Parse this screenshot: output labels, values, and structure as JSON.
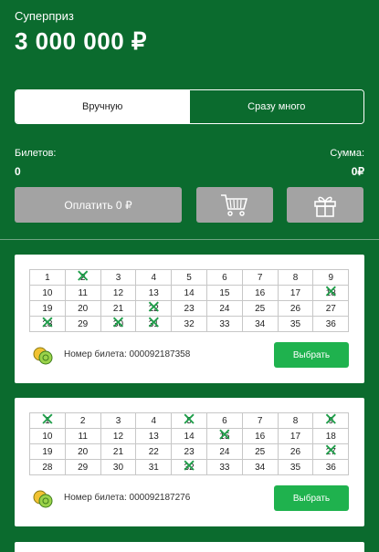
{
  "header": {
    "prize_label": "Суперприз",
    "prize_value": "3 000 000 ₽"
  },
  "mode_toggle": {
    "options": [
      "Вручную",
      "Сразу много"
    ],
    "active": "Вручную"
  },
  "summary": {
    "tickets_label": "Билетов:",
    "tickets_value": "0",
    "sum_label": "Сумма:",
    "sum_value": "0₽"
  },
  "actions": {
    "pay_label": "Оплатить 0 ₽",
    "cart_icon": "cart-icon",
    "gift_icon": "gift-icon"
  },
  "tickets": [
    {
      "numbers": [
        [
          1,
          2,
          3,
          4,
          5,
          6,
          7,
          8,
          9
        ],
        [
          10,
          11,
          12,
          13,
          14,
          15,
          16,
          17,
          18
        ],
        [
          19,
          20,
          21,
          22,
          23,
          24,
          25,
          26,
          27
        ],
        [
          28,
          29,
          30,
          31,
          32,
          33,
          34,
          35,
          36
        ]
      ],
      "crossed": [
        2,
        18,
        22,
        28,
        30,
        31
      ],
      "number_label": "Номер билета: 000092187358",
      "choose_label": "Выбрать"
    },
    {
      "numbers": [
        [
          1,
          2,
          3,
          4,
          5,
          6,
          7,
          8,
          9
        ],
        [
          10,
          11,
          12,
          13,
          14,
          15,
          16,
          17,
          18
        ],
        [
          19,
          20,
          21,
          22,
          23,
          24,
          25,
          26,
          27
        ],
        [
          28,
          29,
          30,
          31,
          32,
          33,
          34,
          35,
          36
        ]
      ],
      "crossed": [
        1,
        5,
        9,
        15,
        27,
        32
      ],
      "number_label": "Номер билета: 000092187276",
      "choose_label": "Выбрать"
    }
  ],
  "colors": {
    "background": "#0b6b2e",
    "accent": "#1fb24e",
    "button_grey": "#a3a3a3"
  }
}
